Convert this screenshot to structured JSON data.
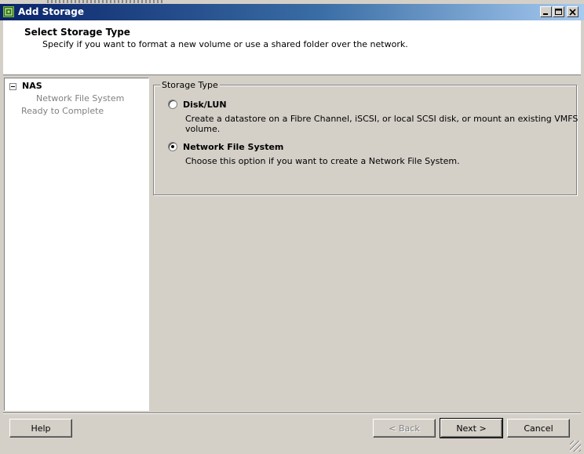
{
  "window": {
    "title": "Add Storage"
  },
  "header": {
    "title": "Select Storage Type",
    "subtitle": "Specify if you want to format a new volume or use a shared folder over the network."
  },
  "nav": {
    "root": "NAS",
    "items": [
      {
        "label": "Network File System"
      },
      {
        "label": "Ready to Complete"
      }
    ]
  },
  "storage_type": {
    "legend": "Storage Type",
    "options": [
      {
        "label": "Disk/LUN",
        "description": "Create a datastore on a Fibre Channel, iSCSI, or local SCSI disk, or mount an existing VMFS volume.",
        "selected": false
      },
      {
        "label": "Network File System",
        "description": "Choose this option if you want to create a Network File System.",
        "selected": true
      }
    ]
  },
  "buttons": {
    "help": "Help",
    "back": "< Back",
    "next": "Next >",
    "cancel": "Cancel"
  },
  "icons": {
    "app": "storage-wizard-icon",
    "minimize": "minimize-icon",
    "maximize": "maximize-icon",
    "close": "close-icon",
    "collapse": "collapse-icon"
  }
}
